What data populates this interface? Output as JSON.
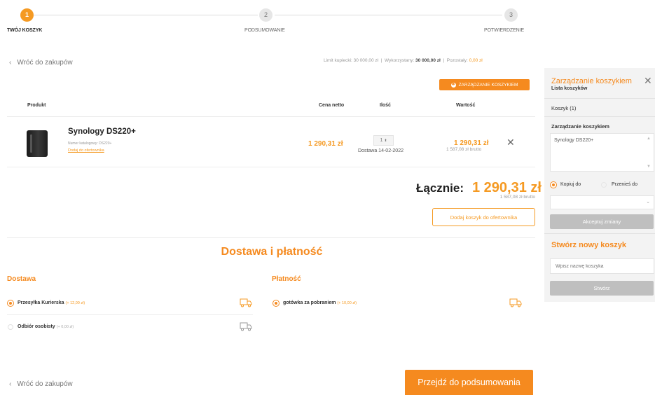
{
  "stepper": {
    "steps": [
      {
        "number": "1",
        "label": "TWÓJ KOSZYK"
      },
      {
        "number": "2",
        "label": "PODSUMOWANIE"
      },
      {
        "number": "3",
        "label": "POTWIERDZENIE"
      }
    ]
  },
  "nav": {
    "back_label": "Wróć do zakupów"
  },
  "limits": {
    "limit_label": "Limit kupiecki:",
    "limit_value": "30 000,00 zł",
    "used_label": "Wykorzystany:",
    "used_value": "30 000,00 zł",
    "left_label": "Pozostały:",
    "left_value": "0,00 zł",
    "sep": "|"
  },
  "cart": {
    "manage_button": "ZARZĄDZANIE KOSZYKIEM",
    "columns": {
      "product": "Produkt",
      "net_price": "Cena netto",
      "qty": "Ilość",
      "value": "Wartość"
    },
    "items": [
      {
        "name": "Synology DS220+",
        "catalog": "Numer katalogowy: DS220+",
        "add_link": "Dodaj do ofertownika",
        "net_price": "1 290,31 zł",
        "qty": "1",
        "delivery": "Dostawa 14-02-2022",
        "value": "1 290,31 zł",
        "brutto": "1 587,08 zł brutto"
      }
    ],
    "total_label": "Łącznie:",
    "total_value": "1 290,31 zł",
    "total_brutto": "1 587,08 zł brutto",
    "add_to_offer": "Dodaj koszyk do ofertownika"
  },
  "shipping": {
    "section_title": "Dostawa i płatność",
    "delivery_title": "Dostawa",
    "payment_title": "Płatność",
    "delivery_options": [
      {
        "label": "Przesyłka Kurierska",
        "cost": "(+ 12,00 zł)",
        "selected": true
      },
      {
        "label": "Odbiór osobisty",
        "cost": "(+ 0,00 zł)",
        "selected": false
      }
    ],
    "payment_options": [
      {
        "label": "gotówka za pobraniem",
        "cost": "(+ 10,00 zł)",
        "selected": true
      }
    ],
    "next_button": "Przejdź do podsumowania"
  },
  "panel": {
    "title": "Zarządzanie koszykiem",
    "subtitle": "Lista koszyków",
    "cart_item": "Koszyk (1)",
    "manage_label": "Zarządzanie koszykiem",
    "textarea_value": "Synology DS220+",
    "copy_label": "Kopiuj do",
    "move_label": "Przenieś do",
    "accept_button": "Akceptuj zmiany",
    "new_cart_title": "Stwórz nowy koszyk",
    "new_cart_placeholder": "Wpisz nazwę koszyka",
    "create_button": "Stwórz"
  },
  "colors": {
    "accent": "#f58a1f",
    "accent_text": "#f59a23",
    "disabled": "#bfbfbf"
  }
}
